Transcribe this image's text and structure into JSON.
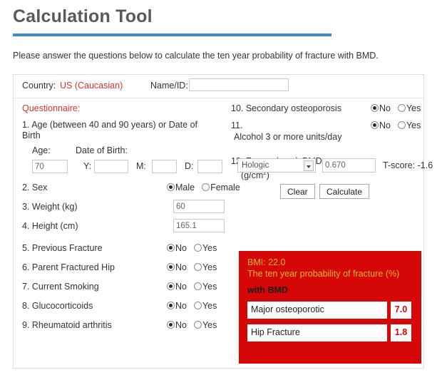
{
  "page": {
    "title": "Calculation Tool",
    "intro": "Please answer the questions below to calculate the ten year probability of fracture with BMD.",
    "accent_blue": "#3e8ec4",
    "accent_red": "#e03030",
    "panel_red": "#d60707",
    "panel_gold": "#e8b72a"
  },
  "country_row": {
    "country_label": "Country:",
    "country_value": "US (Caucasian)",
    "nameid_label": "Name/ID:",
    "nameid_value": "",
    "nameid_placeholder": ""
  },
  "questionnaire": {
    "heading": "Questionnaire:",
    "q1": {
      "text": "1. Age (between 40 and 90 years) or Date of Birth",
      "age_label": "Age:",
      "dob_label": "Date of Birth:",
      "age_value": "70",
      "y_label": "Y:",
      "y_value": "",
      "m_label": "M:",
      "m_value": "",
      "d_label": "D:",
      "d_value": ""
    },
    "q2": {
      "text": "2. Sex",
      "option_male": "Male",
      "option_female": "Female",
      "selected": "Male"
    },
    "q3": {
      "text": "3. Weight (kg)",
      "value": "60"
    },
    "q4": {
      "text": "4. Height (cm)",
      "value": "165.1"
    },
    "q5": {
      "text": "5. Previous Fracture",
      "no": "No",
      "yes": "Yes",
      "selected": "No"
    },
    "q6": {
      "text": "6. Parent Fractured Hip",
      "no": "No",
      "yes": "Yes",
      "selected": "No"
    },
    "q7": {
      "text": "7. Current Smoking",
      "no": "No",
      "yes": "Yes",
      "selected": "No"
    },
    "q8": {
      "text": "8. Glucocorticoids",
      "no": "No",
      "yes": "Yes",
      "selected": "No"
    },
    "q9": {
      "text": "9. Rheumatoid arthritis",
      "no": "No",
      "yes": "Yes",
      "selected": "No"
    },
    "q10": {
      "text": "10. Secondary osteoporosis",
      "no": "No",
      "yes": "Yes",
      "selected": "No"
    },
    "q11": {
      "number": "11.",
      "text": "Alcohol 3 or more units/day",
      "no": "No",
      "yes": "Yes",
      "selected": "No"
    },
    "q12": {
      "text": "12. Femoral neck BMD",
      "unit_prefix": "(g/cm",
      "unit_sup": "2",
      "unit_suffix": ")",
      "device": "Hologic",
      "bmd_value": "0.670",
      "tscore": "T-score: -1.6"
    }
  },
  "buttons": {
    "clear": "Clear",
    "calculate": "Calculate"
  },
  "results": {
    "bmi": "BMI: 22.0",
    "probability_caption": "The ten year probability of fracture (%)",
    "mode_label": "with BMD",
    "rows": [
      {
        "name": "Major osteoporotic",
        "value": "7.0"
      },
      {
        "name": "Hip Fracture",
        "value": "1.8"
      }
    ]
  }
}
